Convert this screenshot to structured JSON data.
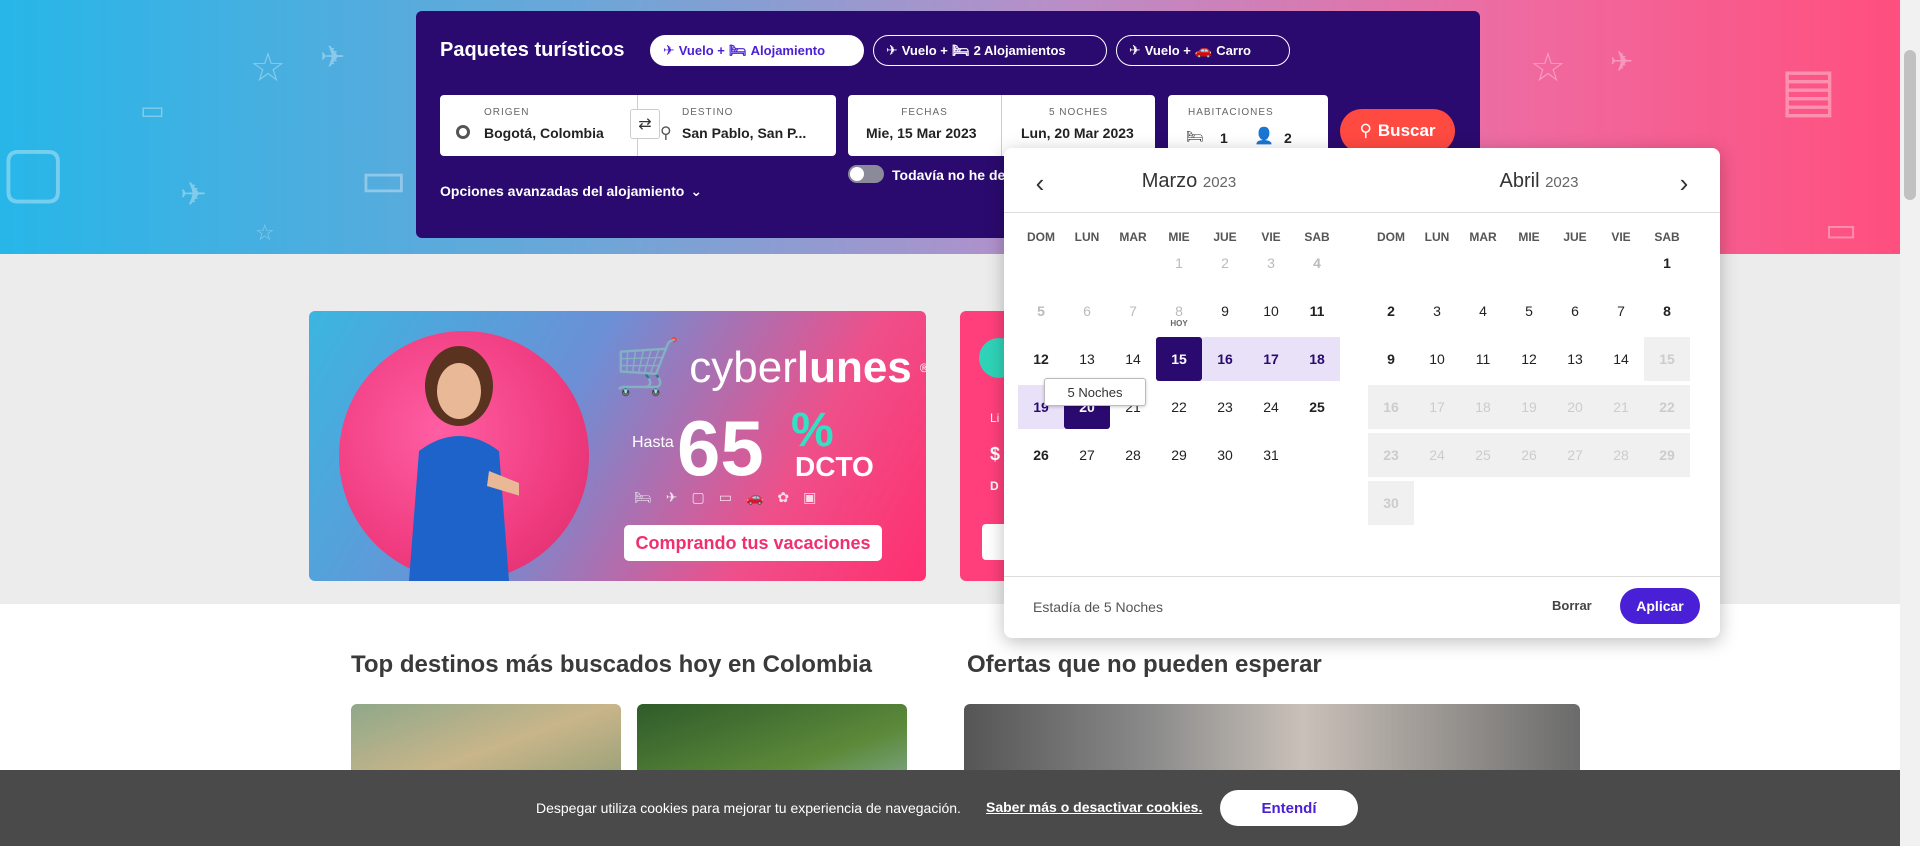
{
  "search": {
    "title": "Paquetes turísticos",
    "tabs": [
      {
        "icon": "✈",
        "prefix": "Vuelo +",
        "icon2": "🛏",
        "label": "Alojamiento"
      },
      {
        "icon": "✈",
        "prefix": "Vuelo +",
        "icon2": "🛏",
        "label": "2 Alojamientos"
      },
      {
        "icon": "✈",
        "prefix": "Vuelo +",
        "icon2": "🚗",
        "label": "Carro"
      }
    ],
    "origin_label": "ORIGEN",
    "origin_value": "Bogotá, Colombia",
    "destination_label": "DESTINO",
    "destination_value": "San Pablo, San P...",
    "dates_label": "FECHAS",
    "date_from": "Mie, 15 Mar 2023",
    "nights_label": "5 NOCHES",
    "date_to": "Lun, 20 Mar 2023",
    "rooms_label": "HABITACIONES",
    "rooms_value": "1",
    "people_value": "2",
    "search_button": "Buscar",
    "advanced_options": "Opciones avanzadas del alojamiento",
    "toggle_label": "Todavía no he decidido"
  },
  "banner_cyber": {
    "logo_plain": "cyber",
    "logo_bold": "lunes",
    "registered": "®",
    "hasta": "Hasta",
    "value": "65",
    "pct": "%",
    "dcto": "DCTO",
    "cta": "Comprando tus vacaciones"
  },
  "banner_2": {
    "t1": "Li",
    "t2": "$",
    "t3": "D"
  },
  "calendar": {
    "month1": {
      "name": "Marzo",
      "year": "2023"
    },
    "month2": {
      "name": "Abril",
      "year": "2023"
    },
    "weekdays": [
      "DOM",
      "LUN",
      "MAR",
      "MIE",
      "JUE",
      "VIE",
      "SAB"
    ],
    "today_label": "HOY",
    "tooltip": "5 Noches",
    "stay_text": "Estadía de 5 Noches",
    "clear": "Borrar",
    "apply": "Aplicar"
  },
  "sections": {
    "top_destinations": "Top destinos más buscados hoy en Colombia",
    "offers": "Ofertas que no pueden esperar"
  },
  "cookie": {
    "text": "Despegar utiliza cookies para mejorar tu experiencia de navegación.",
    "link": "Saber más o desactivar cookies.",
    "button": "Entendí"
  },
  "colors": {
    "primary": "#2a0a6e",
    "accent": "#4a20d6",
    "search_button": "#ff4a42"
  }
}
